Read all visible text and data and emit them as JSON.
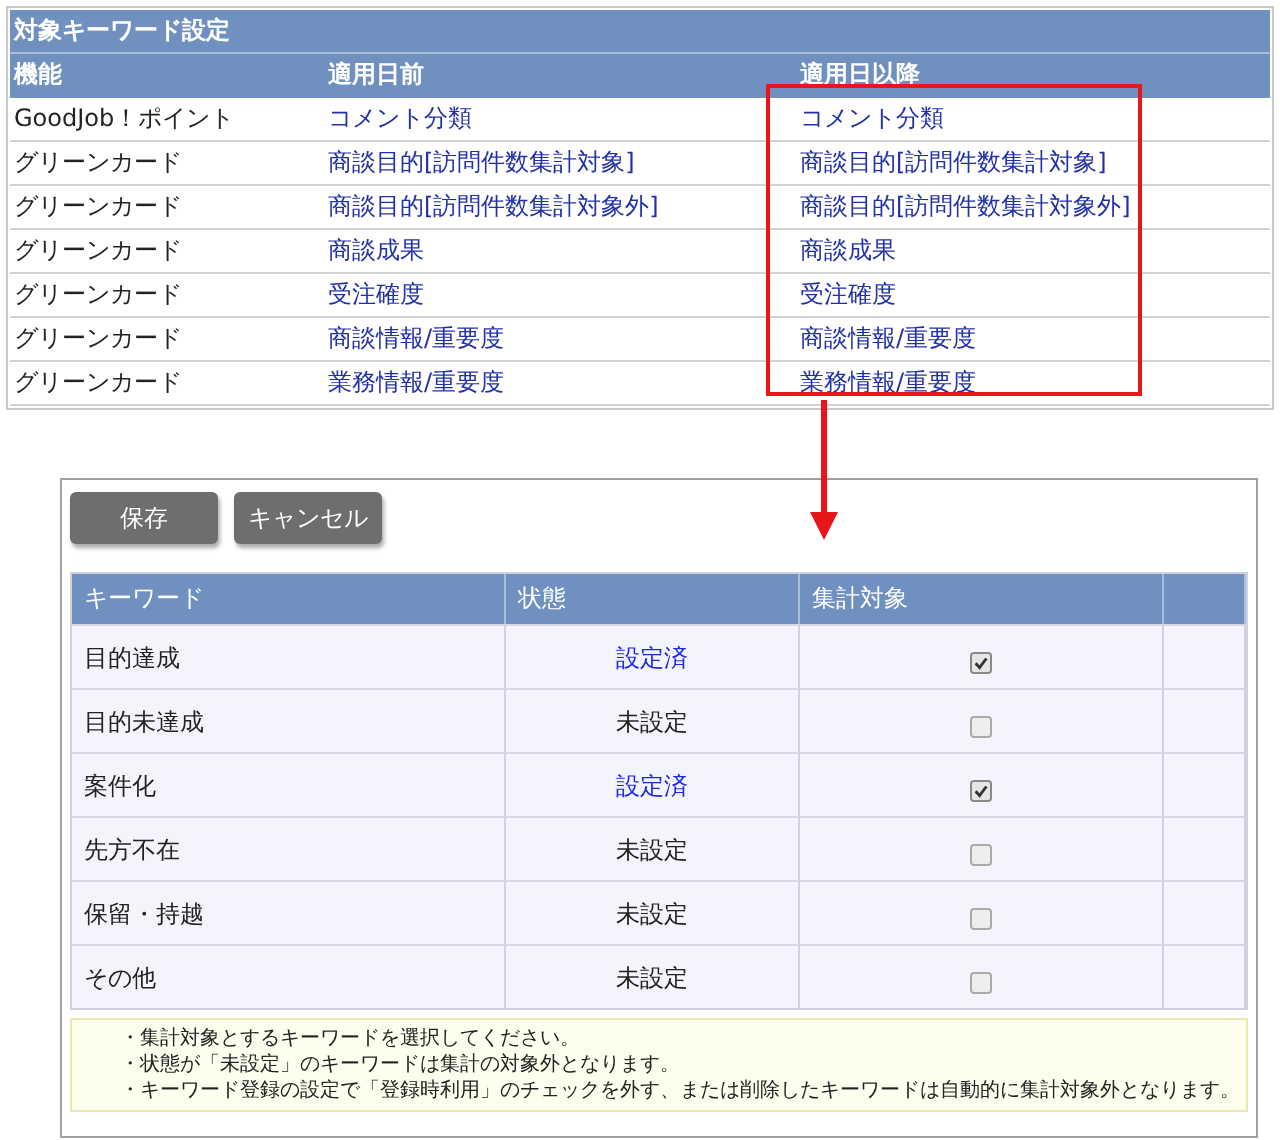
{
  "mapping_table": {
    "title": "対象キーワード設定",
    "columns": [
      "機能",
      "適用日前",
      "適用日以降"
    ],
    "rows": [
      {
        "feature": "GoodJob！ポイント",
        "before": "コメント分類",
        "after": "コメント分類"
      },
      {
        "feature": "グリーンカード",
        "before": "商談目的[訪問件数集計対象]",
        "after": "商談目的[訪問件数集計対象]"
      },
      {
        "feature": "グリーンカード",
        "before": "商談目的[訪問件数集計対象外]",
        "after": "商談目的[訪問件数集計対象外]"
      },
      {
        "feature": "グリーンカード",
        "before": "商談成果",
        "after": "商談成果"
      },
      {
        "feature": "グリーンカード",
        "before": "受注確度",
        "after": "受注確度"
      },
      {
        "feature": "グリーンカード",
        "before": "商談情報/重要度",
        "after": "商談情報/重要度"
      },
      {
        "feature": "グリーンカード",
        "before": "業務情報/重要度",
        "after": "業務情報/重要度"
      }
    ]
  },
  "panel": {
    "buttons": [
      "保存",
      "キャンセル"
    ],
    "columns": [
      "キーワード",
      "状態",
      "集計対象"
    ],
    "rows": [
      {
        "keyword": "目的達成",
        "status": "設定済",
        "status_set": true,
        "checked": true
      },
      {
        "keyword": "目的未達成",
        "status": "未設定",
        "status_set": false,
        "checked": false
      },
      {
        "keyword": "案件化",
        "status": "設定済",
        "status_set": true,
        "checked": true
      },
      {
        "keyword": "先方不在",
        "status": "未設定",
        "status_set": false,
        "checked": false
      },
      {
        "keyword": "保留・持越",
        "status": "未設定",
        "status_set": false,
        "checked": false
      },
      {
        "keyword": "その他",
        "status": "未設定",
        "status_set": false,
        "checked": false
      }
    ],
    "notes": [
      "・集計対象とするキーワードを選択してください。",
      "・状態が「未設定」のキーワードは集計の対象外となります。",
      "・キーワード登録の設定で「登録時利用」のチェックを外す、または削除したキーワードは自動的に集計対象外となります。"
    ]
  }
}
